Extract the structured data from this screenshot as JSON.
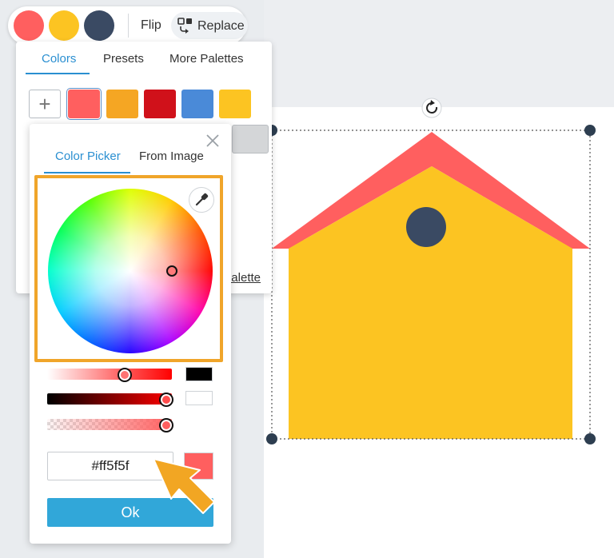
{
  "toolbar": {
    "swatches": [
      {
        "name": "coral",
        "color": "#ff5f5f"
      },
      {
        "name": "yellow",
        "color": "#fcc422"
      },
      {
        "name": "navy",
        "color": "#3a4a63"
      }
    ],
    "flip_label": "Flip",
    "replace_label": "Replace",
    "replace_icon": "replace-icon"
  },
  "palette_panel": {
    "tabs": [
      {
        "label": "Colors",
        "active": true
      },
      {
        "label": "Presets",
        "active": false
      },
      {
        "label": "More Palettes",
        "active": false
      }
    ],
    "add_label": "+",
    "swatches": [
      "#ff5f5f",
      "#f5a623",
      "#d0111a",
      "#4a8ad8",
      "#fcc422"
    ],
    "selected_swatch": "#ff5f5f",
    "extra_swatch": "#d4d6d8",
    "palette_link": "Palette"
  },
  "picker_panel": {
    "tabs": [
      {
        "label": "Color Picker",
        "active": true
      },
      {
        "label": "From Image",
        "active": false
      }
    ],
    "close_icon": "close-icon",
    "eyedropper_icon": "eyedropper-icon",
    "sliders": [
      {
        "name": "saturation",
        "value": 0.63,
        "color": "#ff5f5f"
      },
      {
        "name": "brightness",
        "value": 1.0,
        "color": "#ff0000"
      },
      {
        "name": "opacity",
        "value": 1.0,
        "color": "#ff5f5f"
      }
    ],
    "hex_value": "#ff5f5f",
    "ok_label": "Ok",
    "preview_color": "#ff5f5f"
  },
  "colors": {
    "accent": "#2a8fd1",
    "highlight": "#f0a52a",
    "ok_button": "#31a7d9",
    "roof": "#ff5f5f",
    "house": "#fcc422",
    "window": "#3a4a63"
  },
  "canvas": {
    "rotate_icon": "rotate-icon"
  }
}
